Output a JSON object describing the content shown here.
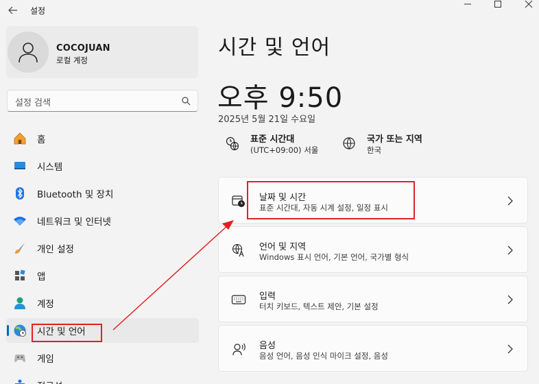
{
  "window": {
    "title": "설정"
  },
  "profile": {
    "name": "COCOJUAN",
    "account_type": "로컬 계정"
  },
  "search": {
    "placeholder": "설정 검색"
  },
  "sidebar": {
    "items": [
      {
        "label": "홈",
        "icon": "home-icon"
      },
      {
        "label": "시스템",
        "icon": "system-icon"
      },
      {
        "label": "Bluetooth 및 장치",
        "icon": "bluetooth-icon"
      },
      {
        "label": "네트워크 및 인터넷",
        "icon": "wifi-icon"
      },
      {
        "label": "개인 설정",
        "icon": "brush-icon"
      },
      {
        "label": "앱",
        "icon": "apps-icon"
      },
      {
        "label": "계정",
        "icon": "account-icon"
      },
      {
        "label": "시간 및 언어",
        "icon": "time-language-icon",
        "selected": true
      },
      {
        "label": "게임",
        "icon": "gamepad-icon"
      },
      {
        "label": "접근성",
        "icon": "accessibility-icon"
      }
    ]
  },
  "main": {
    "title": "시간 및 언어",
    "clock": "오후 9:50",
    "date": "2025년 5월 21일 수요일",
    "timezone": {
      "title": "표준 시간대",
      "value": "(UTC+09:00) 서울"
    },
    "region": {
      "title": "국가 또는 지역",
      "value": "한국"
    },
    "cards": [
      {
        "title": "날짜 및 시간",
        "subtitle": "표준 시간대, 자동 시계 설정, 일정 표시",
        "icon": "calendar-clock-icon"
      },
      {
        "title": "언어 및 지역",
        "subtitle": "Windows 표시 언어, 기본 언어, 국가별 형식",
        "icon": "language-icon"
      },
      {
        "title": "입력",
        "subtitle": "터치 키보드, 텍스트 제안, 기본 설정",
        "icon": "keyboard-icon"
      },
      {
        "title": "음성",
        "subtitle": "음성 언어, 음성 인식 마이크 설정, 음성",
        "icon": "speech-icon"
      }
    ]
  },
  "colors": {
    "accent": "#0067c0",
    "annotation": "#e02020",
    "background": "#f3f3f3"
  }
}
